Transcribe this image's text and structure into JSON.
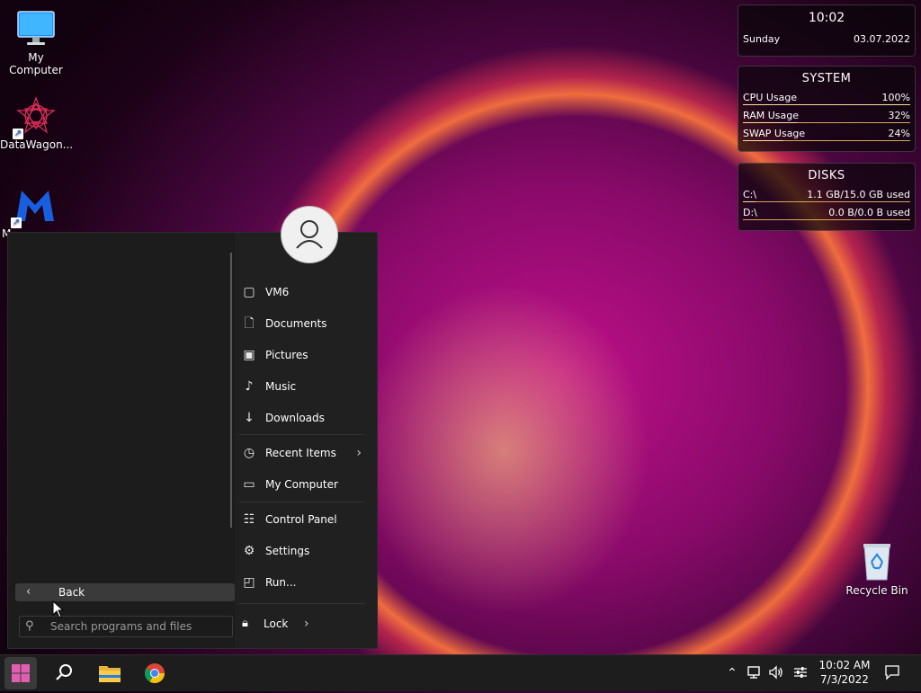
{
  "desktop": {
    "icons": [
      {
        "label": "My Computer"
      },
      {
        "label": "DataWagon..."
      },
      {
        "label": "M"
      },
      {
        "label": "Recycle Bin"
      }
    ]
  },
  "widgets": {
    "clock": {
      "time": "10:02",
      "day": "Sunday",
      "date": "03.07.2022"
    },
    "system": {
      "title": "SYSTEM",
      "rows": [
        {
          "label": "CPU Usage",
          "value": "100%",
          "level": 1.0
        },
        {
          "label": "RAM Usage",
          "value": "32%",
          "level": 0.32
        },
        {
          "label": "SWAP Usage",
          "value": "24%",
          "level": 0.24
        }
      ]
    },
    "disks": {
      "title": "DISKS",
      "rows": [
        {
          "label": "C:\\",
          "value": "1.1 GB/15.0 GB used",
          "level": 0.073
        },
        {
          "label": "D:\\",
          "value": "0.0 B/0.0 B used",
          "level": 0.0
        }
      ]
    }
  },
  "start_menu": {
    "back_label": "Back",
    "search_placeholder": "Search programs and files",
    "items": [
      {
        "label": "VM6",
        "icon": "user-folder-icon"
      },
      {
        "label": "Documents",
        "icon": "document-icon"
      },
      {
        "label": "Pictures",
        "icon": "picture-icon"
      },
      {
        "label": "Music",
        "icon": "music-note-icon"
      },
      {
        "label": "Downloads",
        "icon": "download-arrow-icon"
      },
      {
        "label": "Recent Items",
        "icon": "clock-icon"
      },
      {
        "label": "My Computer",
        "icon": "computer-icon"
      },
      {
        "label": "Control Panel",
        "icon": "control-panel-icon"
      },
      {
        "label": "Settings",
        "icon": "gear-icon"
      },
      {
        "label": "Run...",
        "icon": "run-icon"
      }
    ],
    "lock_label": "Lock"
  },
  "taskbar": {
    "time": "10:02 AM",
    "date": "7/3/2022"
  },
  "colors": {
    "accent": "#0078d4",
    "menu_bg": "#202020",
    "taskbar_bg": "#1d1d1d",
    "widget_bar": "#d9a45a"
  }
}
